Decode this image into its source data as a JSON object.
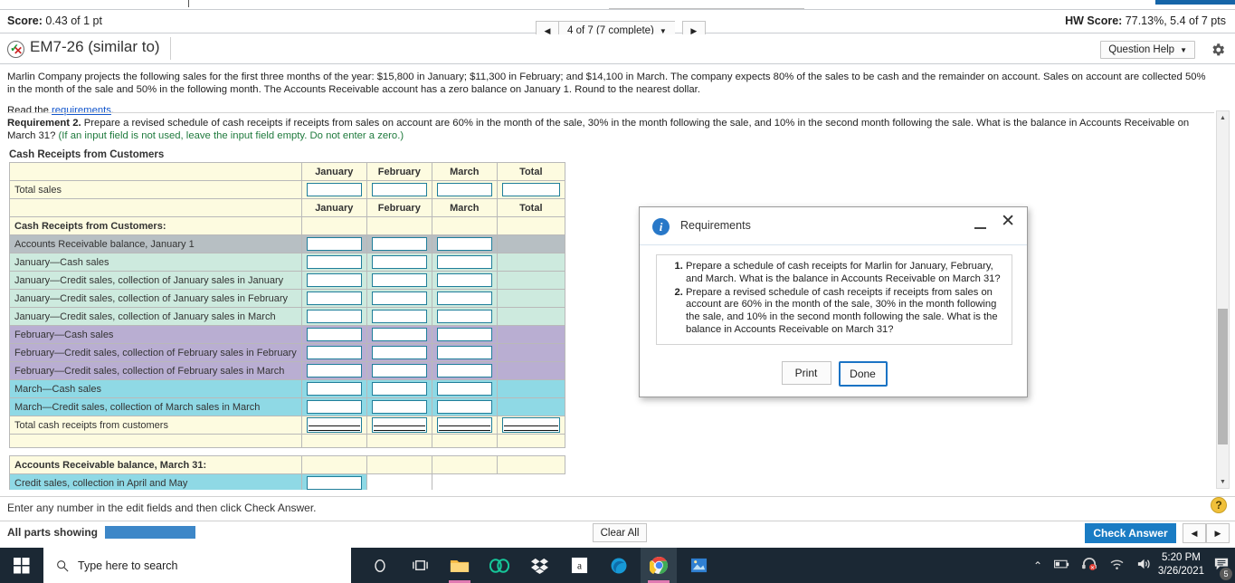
{
  "topbar": {
    "score_label": "Score:",
    "score_value": "0.43 of 1 pt",
    "hw_score_label": "HW Score:",
    "hw_score_value": "77.13%, 5.4 of 7 pts",
    "pager": {
      "prev": "◀",
      "label": "4 of 7 (7 complete)",
      "caret": "▼",
      "next": "▶"
    }
  },
  "question": {
    "title": "EM7-26 (similar to)",
    "help_button": "Question Help",
    "help_caret": "▼",
    "icon": "check-x-circle-icon",
    "gear": "gear-icon"
  },
  "problem": {
    "paragraph": "Marlin Company projects the following sales for the first three months of the year: $15,800 in January; $11,300 in February; and $14,100 in March. The company expects 80% of the sales to be cash and the remainder on account. Sales on account are collected 50% in the month of the sale and 50% in the following month. The Accounts Receivable account has a zero balance on January 1. Round to the nearest dollar.",
    "read_prefix": "Read the ",
    "read_link": "requirements",
    "read_suffix": ".",
    "requirement_label": "Requirement 2.",
    "requirement_text": " Prepare a revised schedule of cash receipts if receipts from sales on account are 60% in the month of the sale, 30% in the month following the sale, and 10% in the second month following the sale. What is the balance in Accounts Receivable on March 31? ",
    "requirement_note": "(If an input field is not used, leave the input field empty. Do not enter a zero.)"
  },
  "worksheet": {
    "title": "Cash Receipts from Customers",
    "columns": [
      "January",
      "February",
      "March",
      "Total"
    ],
    "rows": [
      {
        "label": "",
        "type": "header"
      },
      {
        "label": "Total sales",
        "type": "input-total",
        "style": "cream"
      },
      {
        "label": "",
        "type": "header"
      },
      {
        "label": "Cash Receipts from Customers:",
        "type": "section",
        "style": "cream"
      },
      {
        "label": "Accounts Receivable balance, January 1",
        "type": "input3",
        "style": "gray"
      },
      {
        "label": "January—Cash sales",
        "type": "input3",
        "style": "mint"
      },
      {
        "label": "January—Credit sales, collection of January sales in January",
        "type": "input3",
        "style": "mint"
      },
      {
        "label": "January—Credit sales, collection of January sales in February",
        "type": "input3",
        "style": "mint"
      },
      {
        "label": "January—Credit sales, collection of January sales in March",
        "type": "input3",
        "style": "mint"
      },
      {
        "label": "February—Cash sales",
        "type": "input3",
        "style": "purple"
      },
      {
        "label": "February—Credit sales, collection of February sales in February",
        "type": "input3",
        "style": "purple"
      },
      {
        "label": "February—Credit sales, collection of February sales in March",
        "type": "input3",
        "style": "purple"
      },
      {
        "label": "March—Cash sales",
        "type": "input3",
        "style": "cyan"
      },
      {
        "label": "March—Credit sales, collection of March sales in March",
        "type": "input3",
        "style": "cyan"
      },
      {
        "label": "Total cash receipts from customers",
        "type": "input-grand",
        "style": "cream"
      }
    ],
    "footer_section": "Accounts Receivable balance, March 31:",
    "footer_row": "Credit sales, collection in April and May"
  },
  "dialog": {
    "title": "Requirements",
    "info_glyph": "i",
    "minimize": "minimize-icon",
    "close": "✕",
    "items": [
      "Prepare a schedule of cash receipts for Marlin for January, February, and March. What is the balance in Accounts Receivable on March 31?",
      "Prepare a revised schedule of cash receipts if receipts from sales on account are 60% in the month of the sale, 30% in the month following the sale, and 10% in the second month following the sale. What is the balance in Accounts Receivable on March 31?"
    ],
    "print_button": "Print",
    "done_button": "Done"
  },
  "bottom": {
    "hint": "Enter any number in the edit fields and then click Check Answer.",
    "all_parts": "All parts showing",
    "clear_all": "Clear All",
    "check_answer": "Check Answer",
    "prev": "◀",
    "next": "▶",
    "help_glyph": "?"
  },
  "taskbar": {
    "search_placeholder": "Type here to search",
    "time": "5:20 PM",
    "date": "3/26/2021",
    "notification_count": "5",
    "apps": [
      "cortana-icon",
      "task-view-icon",
      "file-explorer-icon",
      "opera-icon",
      "dropbox-icon",
      "amazon-icon",
      "edge-icon",
      "chrome-icon",
      "photos-icon"
    ]
  }
}
